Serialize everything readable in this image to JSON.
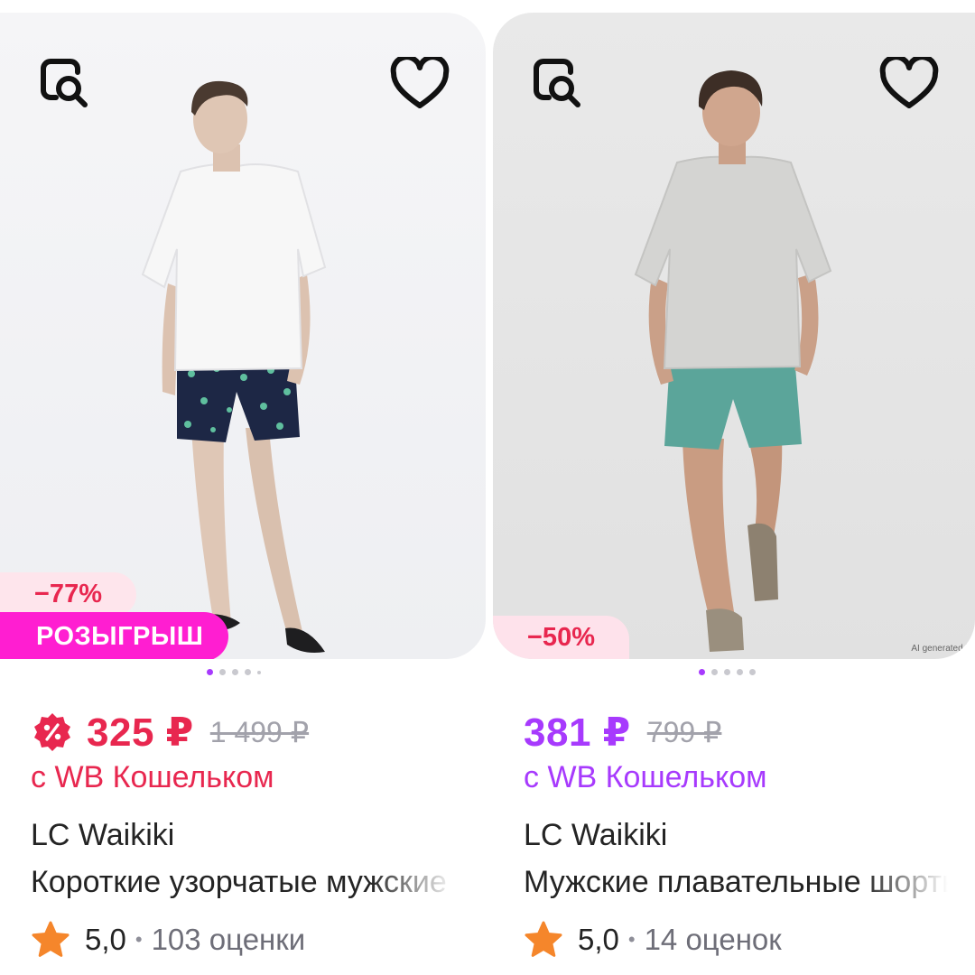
{
  "products": [
    {
      "discount": "−77%",
      "promo": "РОЗЫГРЫШ",
      "price": "325 ₽",
      "old_price": "1 499 ₽",
      "wallet_label": "с WB Кошельком",
      "brand": "LC Waikiki",
      "name": "Короткие узорчатые мужские шорты",
      "rating": "5,0",
      "separator": "•",
      "reviews": "103 оценки",
      "accent": "#e8274f",
      "image_slides": 5,
      "active_slide": 1
    },
    {
      "discount": "−50%",
      "ai_note": "AI generated im",
      "price": "381 ₽",
      "old_price": "799 ₽",
      "wallet_label": "с WB Кошельком",
      "brand": "LC Waikiki",
      "name": "Мужские плавательные шорты",
      "rating": "5,0",
      "separator": "•",
      "reviews": "14 оценок",
      "accent": "#a73afd",
      "image_slides": 5,
      "active_slide": 1
    }
  ],
  "icons": {
    "similar": "similar-search-icon",
    "favorite": "heart-icon",
    "wallet": "wallet-discount-icon",
    "rating": "star-icon"
  },
  "colors": {
    "red": "#e8274f",
    "purple": "#a73afd",
    "promo_pink": "#ff1ed1",
    "star": "#f5862b"
  }
}
